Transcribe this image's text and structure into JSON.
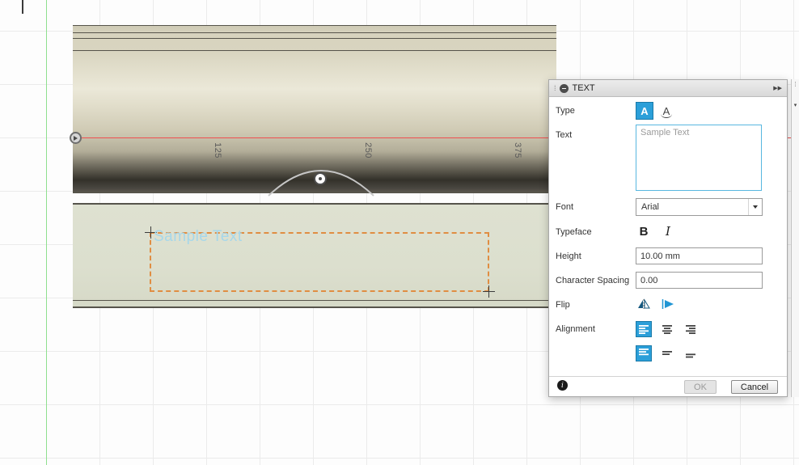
{
  "canvas": {
    "dimension_labels": [
      "125",
      "250",
      "375"
    ],
    "preview_text": "Sample Text"
  },
  "colors": {
    "accent_blue": "#2b9fd9",
    "selection_orange": "#e08d42",
    "axis_red": "#f04f4f",
    "axis_green": "#8fe08f",
    "preview_text_blue": "#a6d7ea",
    "model_beige": "#d9d5c0"
  },
  "panel": {
    "title": "TEXT",
    "expand_icon": "▶▶",
    "fields": {
      "type_label": "Type",
      "type_text_glyph": "A",
      "type_path_glyph": "A",
      "text_label": "Text",
      "text_placeholder": "Sample Text",
      "text_value": "",
      "font_label": "Font",
      "font_value": "Arial",
      "typeface_label": "Typeface",
      "bold": "B",
      "italic": "I",
      "height_label": "Height",
      "height_value": "10.00 mm",
      "spacing_label": "Character Spacing",
      "spacing_value": "0.00",
      "flip_label": "Flip",
      "alignment_label": "Alignment"
    },
    "footer": {
      "info_glyph": "i",
      "ok": "OK",
      "cancel": "Cancel"
    }
  },
  "side_strip": {
    "grip_glyph": "⁞",
    "collapse_glyph": "▾"
  }
}
